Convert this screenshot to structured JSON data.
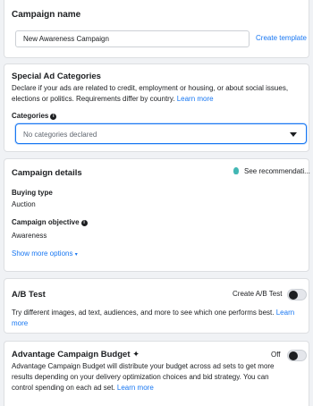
{
  "campaign_name": {
    "title": "Campaign name",
    "value": "New Awareness Campaign",
    "create_template": "Create template"
  },
  "special_ad": {
    "title": "Special Ad Categories",
    "description": "Declare if your ads are related to credit, employment or housing, or about social issues, elections or politics. Requirements differ by country.",
    "learn_more": "Learn more",
    "categories_label": "Categories",
    "categories_value": "No categories declared"
  },
  "details": {
    "title": "Campaign details",
    "see_recommendations": "See recommendati...",
    "buying_type_label": "Buying type",
    "buying_type_value": "Auction",
    "objective_label": "Campaign objective",
    "objective_value": "Awareness",
    "show_more": "Show more options"
  },
  "ab_test": {
    "title": "A/B Test",
    "create_label": "Create A/B Test",
    "description": "Try different images, ad text, audiences, and more to see which one performs best.",
    "learn_more": "Learn more"
  },
  "budget": {
    "title": "Advantage Campaign Budget",
    "sparkle": "✦",
    "toggle_label": "Off",
    "description": "Advantage Campaign Budget will distribute your budget across ad sets to get more results depending on your delivery optimization choices and bid strategy. You can control spending on each ad set.",
    "learn_more": "Learn more"
  },
  "colors": {
    "link": "#1877f2",
    "background": "#f0f2f5",
    "bulb": "#42b7b4"
  }
}
